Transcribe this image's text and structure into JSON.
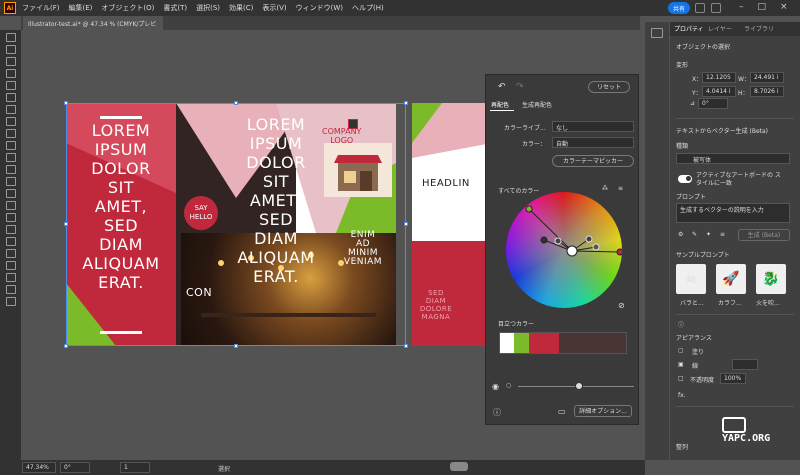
{
  "menubar": {
    "items": [
      "ファイル(F)",
      "編集(E)",
      "オブジェクト(O)",
      "書式(T)",
      "選択(S)",
      "効果(C)",
      "表示(V)",
      "ウィンドウ(W)",
      "ヘルプ(H)"
    ],
    "share_label": "共有"
  },
  "document_tab": {
    "label": "Illustrator-test.ai* @ 47.34 % (CMYK/プレビュー)",
    "close": "×"
  },
  "artwork": {
    "lorem_left": [
      "LOREM",
      "IPSUM",
      "DOLOR",
      "SIT",
      "AMET,",
      "SED",
      "DIAM",
      "ALIQUAM",
      "ERAT."
    ],
    "lorem_mid": [
      "LOREM",
      "IPSUM",
      "DOLOR",
      "SIT",
      "AMET,",
      "SED",
      "DIAM",
      "ALIQUAM",
      "ERAT."
    ],
    "say_hello": [
      "SAY",
      "HELLO"
    ],
    "company_logo": [
      "COMPANY",
      "LOGO"
    ],
    "contact": "CON",
    "enim": [
      "ENIM",
      "AD",
      "MINIM",
      "VENIAM"
    ],
    "headline": "HEADLIN",
    "sed": [
      "SED",
      "DIAM",
      "DOLORE",
      "MAGNA"
    ]
  },
  "recolor_panel": {
    "reset_label": "リセット",
    "tab_recolor": "再配色",
    "tab_gen": "生成再配色",
    "library_label": "カラーライブ...",
    "library_value": "なし",
    "colors_label": "カラー：",
    "colors_value": "自動",
    "theme_picker": "カラーテーマピッカー",
    "all_colors": "すべてのカラー",
    "prominent_colors": "目立つカラー",
    "advanced_options": "詳細オプション..."
  },
  "prominent_swatches": [
    "#ffffff",
    "#7bbb2a",
    "#c0283c",
    "#4a3535"
  ],
  "properties": {
    "tabs": [
      "プロパティ",
      "レイヤー",
      "ライブラリ"
    ],
    "selection_title": "オブジェクトの選択",
    "transform_label": "変形",
    "x_label": "X：",
    "x_value": "12.1205",
    "y_label": "Y：",
    "y_value": "4.0414 i",
    "w_label": "W：",
    "w_value": "24.491 i",
    "h_label": "H：",
    "h_value": "8.7026 i",
    "angle_value": "0°",
    "text_to_vector": "テキストからベクター生成 (Beta)",
    "type_label": "種類",
    "type_value": "被写体",
    "active_artboard_style": "アクティブなアートボードの スタイルに一致",
    "prompt_label": "プロンプト",
    "prompt_placeholder": "生成するベクターの説明を入力",
    "generate_label": "生成 (Beta)",
    "sample_prompts": "サンプルプロンプト",
    "thumbs": [
      "バラと...",
      "カラフ...",
      "火を吹..."
    ],
    "appearance": "アピアランス",
    "fill": "塗り",
    "stroke": "線",
    "opacity": "不透明度",
    "opacity_value": "100%",
    "fx": "fx.",
    "align": "整列"
  },
  "status": {
    "zoom": "47.34%",
    "angle": "0°",
    "artboard": "1",
    "mode": "選択"
  },
  "watermark": "YAPC.ORG"
}
